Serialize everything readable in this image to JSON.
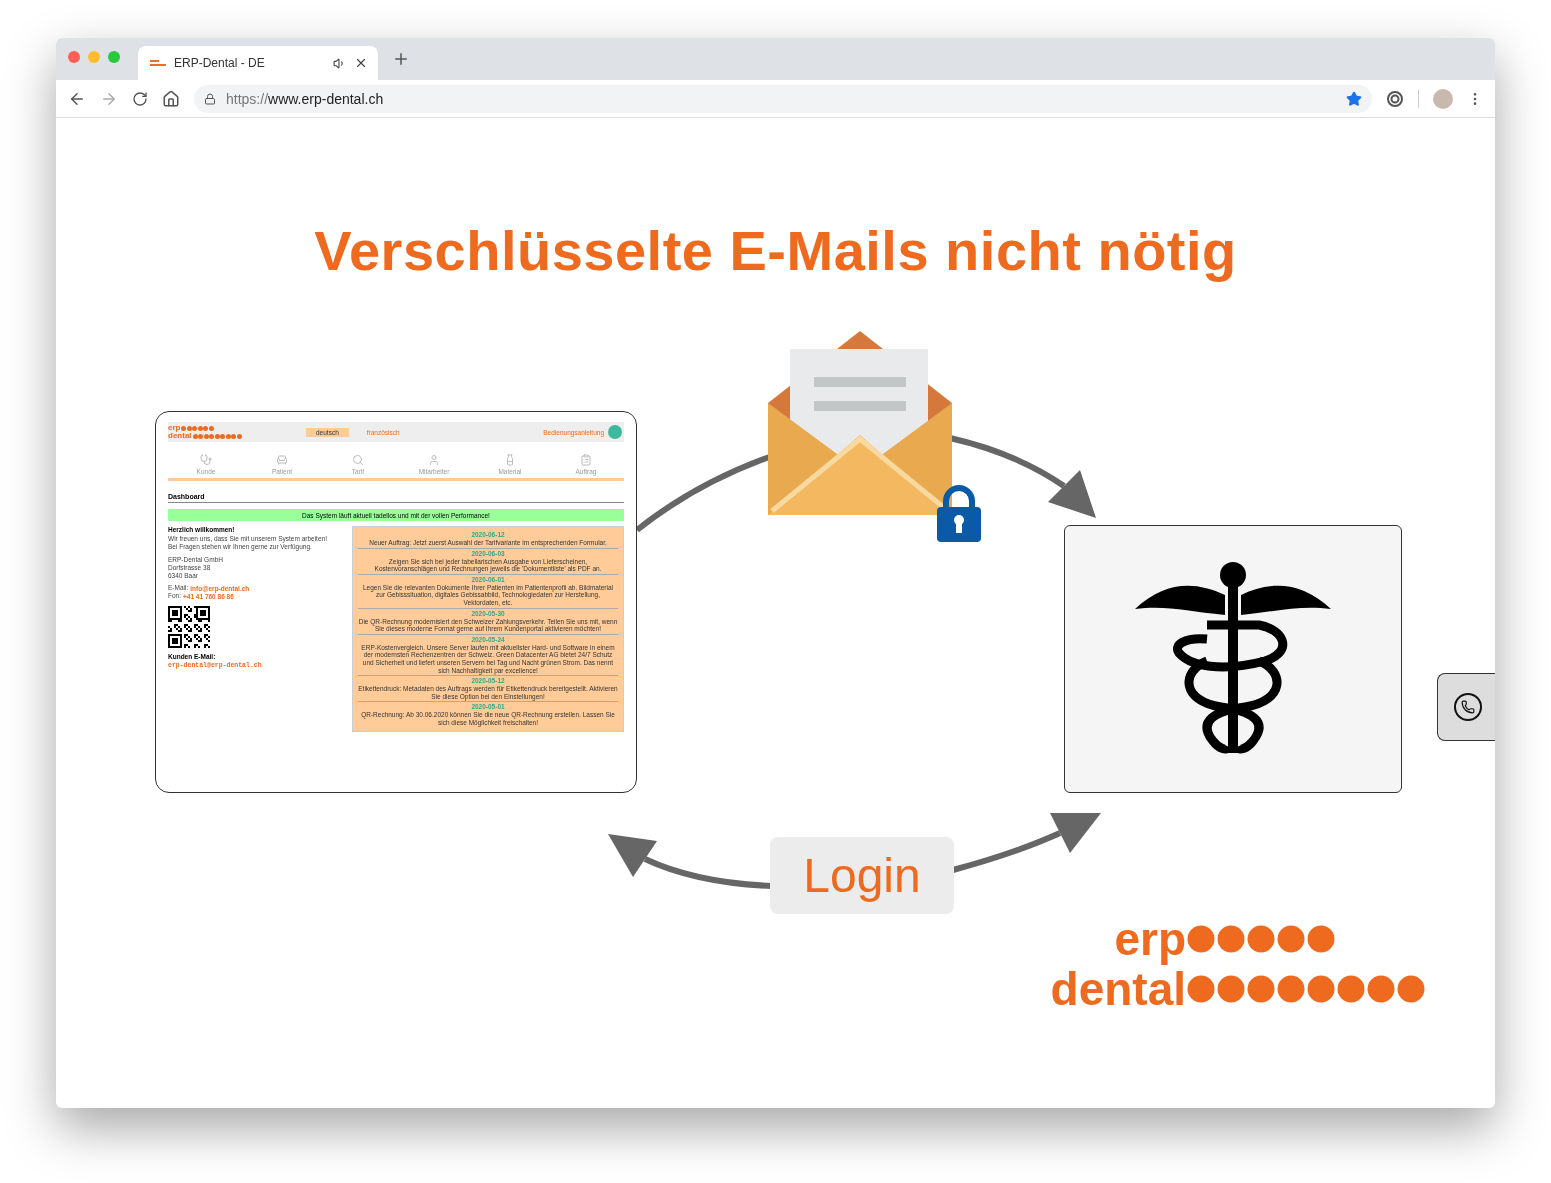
{
  "browser": {
    "tab": {
      "title": "ERP-Dental - DE"
    },
    "url": {
      "scheme": "https://",
      "host": "www.erp-dental.ch"
    }
  },
  "page": {
    "headline": "Verschlüsselte E-Mails nicht nötig",
    "preview": {
      "header": {
        "logo": [
          "erp",
          "dental"
        ],
        "languages": [
          {
            "label": "deutsch",
            "selected": true
          },
          {
            "label": "französisch",
            "selected": false
          }
        ],
        "manual": "Bedienungsanleitung"
      },
      "nav": [
        {
          "kind": "caduceus",
          "label": "Kunde"
        },
        {
          "kind": "chair",
          "label": "Patient"
        },
        {
          "kind": "search",
          "label": "Tarif"
        },
        {
          "kind": "user",
          "label": "Mitarbeiter"
        },
        {
          "kind": "jar",
          "label": "Material"
        },
        {
          "kind": "clipboard",
          "label": "Auftrag"
        }
      ],
      "dashboard_title": "Dashboard",
      "status_message": "Das System läuft aktuell tadellos und mit der vollen Performance!",
      "welcome": {
        "title": "Herzlich willkommen!",
        "lines": [
          "Wir freuen uns, dass Sie mit unserem System arbeiten!",
          "Bei Fragen stehen wir Ihnen gerne zur Verfügung."
        ],
        "address": [
          "ERP-Dental GmbH",
          "Dorfstrasse 38",
          "6340 Baar"
        ],
        "email_label": "E-Mail:",
        "email": "info@erp-dental.ch",
        "phone_label": "Fon:",
        "phone": "+41 41 760 86 86",
        "customer_email_title": "Kunden E-Mail:",
        "customer_email": "erp-dental@erp-dental.ch"
      },
      "news": [
        {
          "date": "2020-06-12",
          "text": "Neuer Auftrag: Jetzt zuerst Auswahl der Tarifvariante im entsprechenden Formular."
        },
        {
          "date": "2020-06-03",
          "text": "Zeigen Sie sich bei jeder tabellarischen Ausgabe von Lieferscheinen, Kostenvoranschlägen und Rechnungen jeweils die 'Dokumentliste' als PDF an."
        },
        {
          "date": "2020-06-01",
          "text": "Legen Sie die relevanten Dokumente Ihrer Patienten im Patientenprofil ab. Bildmaterial zur Gebisssituation, digitales Gebissabbild, Technologiedaten zur Herstellung, Vektordaten, etc."
        },
        {
          "date": "2020-05-30",
          "text": "Die QR-Rechnung modernisiert den Schweizer Zahlungsverkehr. Teilen Sie uns mit, wenn Sie dieses moderne Format gerne auf Ihrem Kundenportal aktivieren möchten!"
        },
        {
          "date": "2020-05-24",
          "text": "ERP-Kostenvergleich. Unsere Server laufen mit aktuellster Hard- und Software in einem der modernsten Rechenzentren der Schweiz. Green Datacenter AG bietet 24/7 Schutz und Sicherheit und liefert unseren Servern bei Tag und Nacht grünen Strom. Das nennt sich Nachhaltigkeit par excellence!"
        },
        {
          "date": "2020-05-12",
          "text": "Etikettendruck: Metadaten des Auftrags werden für Etikettendruck bereitgestellt. Aktivieren Sie diese Option bei den Einstellungen!"
        },
        {
          "date": "2020-05-01",
          "text": "QR-Rechnung: Ab 30.06.2020 können Sie die neue QR-Rechnung erstellen. Lassen Sie sich diese Möglichkeit freischalten!"
        }
      ]
    },
    "login": "Login",
    "logo": [
      "erp",
      "dental"
    ]
  }
}
